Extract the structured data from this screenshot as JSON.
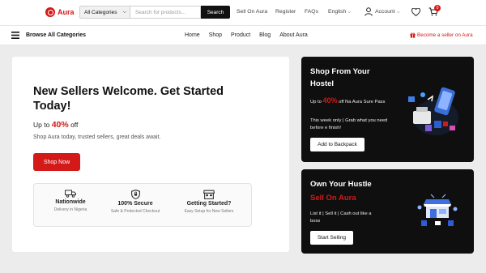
{
  "brand": {
    "name": "Aura",
    "accent": "#d41919"
  },
  "header": {
    "category_select": "All Categories",
    "search_placeholder": "Search for products...",
    "search_button": "Search",
    "links": [
      "Sell On Aura",
      "Register",
      "FAQs"
    ],
    "language": "English",
    "account": "Account",
    "cart_count": "0",
    "icons": [
      "user-icon",
      "heart-icon",
      "cart-icon"
    ]
  },
  "nav": {
    "browse": "Browse All Categories",
    "links": [
      "Home",
      "Shop",
      "Product",
      "Blog",
      "About Aura"
    ],
    "seller_link": "Become a seller on Aura"
  },
  "hero": {
    "title": "New Sellers Welcome. Get Started Today!",
    "offer_prefix": "Up to ",
    "offer_pct": "40%",
    "offer_suffix": " off",
    "subtitle": "Shop Aura today, trusted sellers, great deals await.",
    "button": "Shop Now",
    "features": [
      {
        "icon": "truck-icon",
        "title": "Nationwide",
        "subtitle": "Delivery in Nigeria"
      },
      {
        "icon": "shield-icon",
        "title": "100% Secure",
        "subtitle": "Safe & Protected Checkout"
      },
      {
        "icon": "store-icon",
        "title": "Getting Started?",
        "subtitle": "Easy Setup for New Sellers"
      }
    ]
  },
  "promo1": {
    "title": "Shop From Your Hostel",
    "offer_prefix": "Up to ",
    "offer_pct": "40%",
    "offer_suffix": " off Na Aura Sure Pass",
    "line2": "This week only | Grab what you need before e finish!",
    "button": "Add to Backpack"
  },
  "promo2": {
    "title": "Own Your Hustle",
    "red_heading": "Sell On Aura",
    "line": "List it | Sell it | Cash out like a boss",
    "button": "Start Selling"
  }
}
